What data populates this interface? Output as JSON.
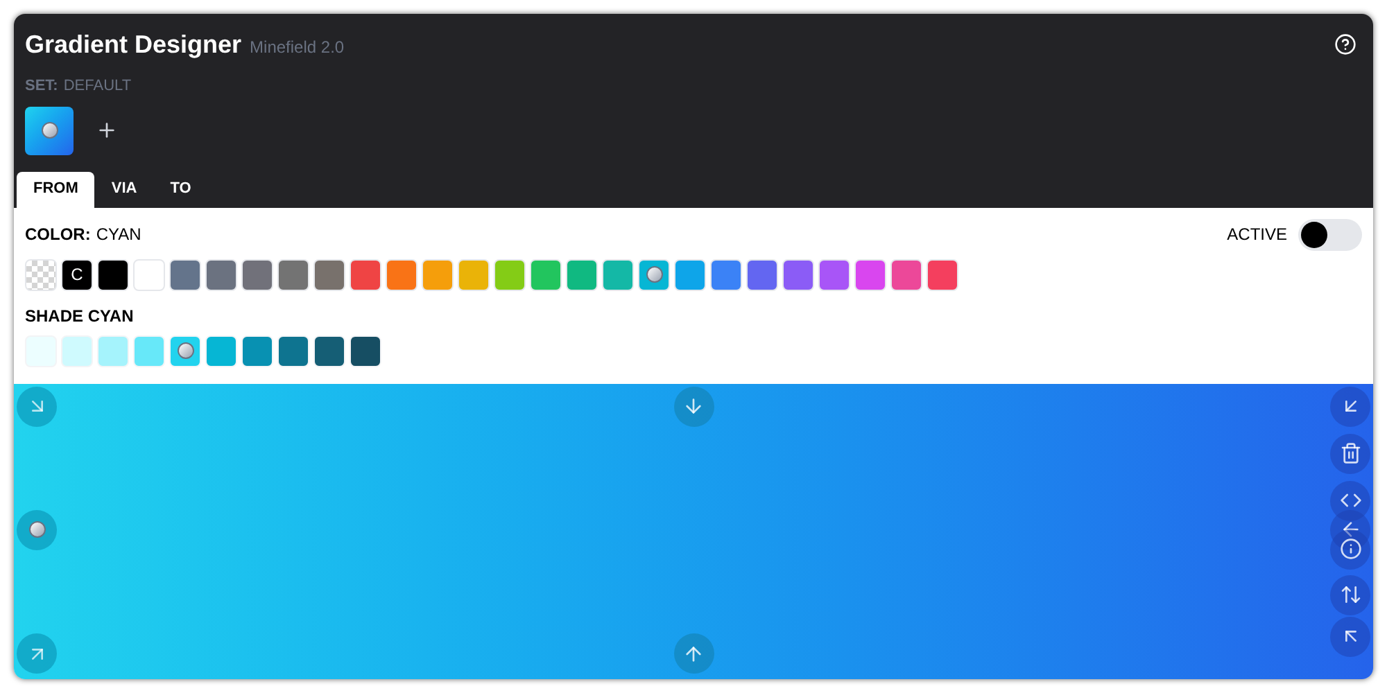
{
  "header": {
    "title": "Gradient Designer",
    "subtitle": "Minefield 2.0",
    "set_label": "SET:",
    "set_value": "DEFAULT"
  },
  "tabs": [
    {
      "label": "FROM",
      "selected": true
    },
    {
      "label": "VIA",
      "selected": false
    },
    {
      "label": "TO",
      "selected": false
    }
  ],
  "color": {
    "label": "COLOR:",
    "value": "CYAN"
  },
  "active_toggle": {
    "label": "ACTIVE",
    "on": false
  },
  "swatches": [
    {
      "kind": "transparent",
      "selected": false
    },
    {
      "kind": "letter",
      "text": "C",
      "color": "#000000",
      "selected": false
    },
    {
      "kind": "solid",
      "color": "#000000",
      "selected": false
    },
    {
      "kind": "solid",
      "color": "#ffffff",
      "selected": false
    },
    {
      "kind": "solid",
      "color": "#64748b",
      "selected": false
    },
    {
      "kind": "solid",
      "color": "#6b7280",
      "selected": false
    },
    {
      "kind": "solid",
      "color": "#71717a",
      "selected": false
    },
    {
      "kind": "solid",
      "color": "#737373",
      "selected": false
    },
    {
      "kind": "solid",
      "color": "#78716c",
      "selected": false
    },
    {
      "kind": "solid",
      "color": "#ef4444",
      "selected": false
    },
    {
      "kind": "solid",
      "color": "#f97316",
      "selected": false
    },
    {
      "kind": "solid",
      "color": "#f59e0b",
      "selected": false
    },
    {
      "kind": "solid",
      "color": "#eab308",
      "selected": false
    },
    {
      "kind": "solid",
      "color": "#84cc16",
      "selected": false
    },
    {
      "kind": "solid",
      "color": "#22c55e",
      "selected": false
    },
    {
      "kind": "solid",
      "color": "#10b981",
      "selected": false
    },
    {
      "kind": "solid",
      "color": "#14b8a6",
      "selected": false
    },
    {
      "kind": "solid",
      "color": "#06b6d4",
      "selected": true
    },
    {
      "kind": "solid",
      "color": "#0ea5e9",
      "selected": false
    },
    {
      "kind": "solid",
      "color": "#3b82f6",
      "selected": false
    },
    {
      "kind": "solid",
      "color": "#6366f1",
      "selected": false
    },
    {
      "kind": "solid",
      "color": "#8b5cf6",
      "selected": false
    },
    {
      "kind": "solid",
      "color": "#a855f7",
      "selected": false
    },
    {
      "kind": "solid",
      "color": "#d946ef",
      "selected": false
    },
    {
      "kind": "solid",
      "color": "#ec4899",
      "selected": false
    },
    {
      "kind": "solid",
      "color": "#f43f5e",
      "selected": false
    }
  ],
  "shade_label": "SHADE CYAN",
  "shades": [
    {
      "color": "#ecfeff",
      "selected": false
    },
    {
      "color": "#cffafe",
      "selected": false
    },
    {
      "color": "#a5f3fc",
      "selected": false
    },
    {
      "color": "#67e8f9",
      "selected": false
    },
    {
      "color": "#22d3ee",
      "selected": true
    },
    {
      "color": "#06b6d4",
      "selected": false
    },
    {
      "color": "#0891b2",
      "selected": false
    },
    {
      "color": "#0e7490",
      "selected": false
    },
    {
      "color": "#155e75",
      "selected": false
    },
    {
      "color": "#164e63",
      "selected": false
    }
  ]
}
